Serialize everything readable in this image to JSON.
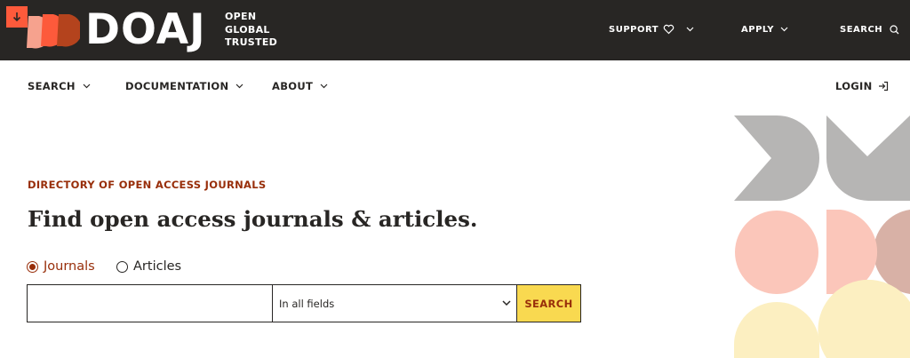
{
  "brand": {
    "name": "DOAJ",
    "tagline": [
      "OPEN",
      "GLOBAL",
      "TRUSTED"
    ],
    "colors": {
      "dark_bar": "#282624",
      "accent_orange": "#fd5a3b",
      "accent_rust": "#982e0a",
      "search_button": "#f9d950"
    }
  },
  "skip_link": {
    "icon": "arrow-down-icon"
  },
  "top_nav": {
    "support": {
      "label": "SUPPORT",
      "icon": "heart-icon"
    },
    "apply": {
      "label": "APPLY"
    },
    "search": {
      "label": "SEARCH",
      "icon": "search-icon"
    }
  },
  "main_nav": {
    "search": "SEARCH",
    "documentation": "DOCUMENTATION",
    "about": "ABOUT",
    "login": "LOGIN"
  },
  "hero": {
    "eyebrow": "DIRECTORY OF OPEN ACCESS JOURNALS",
    "headline": "Find open access journals & articles."
  },
  "search_form": {
    "options": [
      {
        "label": "Journals",
        "selected": true
      },
      {
        "label": "Articles",
        "selected": false
      }
    ],
    "query_value": "",
    "field_select": "In all fields",
    "submit_label": "SEARCH"
  }
}
